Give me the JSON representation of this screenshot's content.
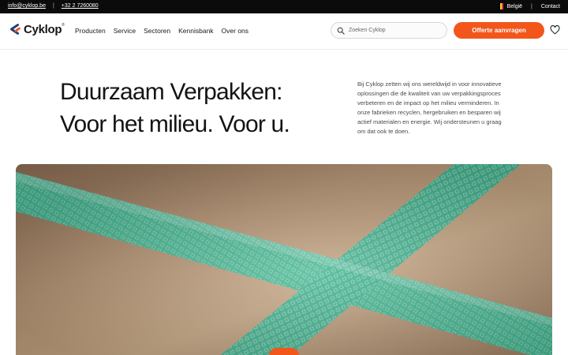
{
  "topbar": {
    "email": "info@cyklop.be",
    "phone": "+32 2 7260080",
    "country": "België",
    "contact": "Contact",
    "flag_colors": [
      "#000000",
      "#FDDA24",
      "#EF3340"
    ]
  },
  "header": {
    "logo_text": "Cyklop",
    "logo_reg": "®",
    "nav": [
      "Producten",
      "Service",
      "Sectoren",
      "Kennisbank",
      "Over ons"
    ],
    "search_placeholder": "Zoeken Cyklop",
    "cta_label": "Offerte aanvragen",
    "icons": {
      "search": "search-icon",
      "wishlist": "heart-icon",
      "logo": "cyklop-logo-icon"
    }
  },
  "hero": {
    "headline_line1": "Duurzaam Verpakken:",
    "headline_line2": "Voor het milieu. Voor u.",
    "intro": "Bij Cyklop zetten wij ons wereldwijd in voor innovatieve oplossingen die de kwaliteit van uw verpakkingsproces verbeteren en de impact op het milieu verminderen. In onze fabrieken recyclen, hergebruiken en besparen wij actief materialen en energie. Wij ondersteunen u graag om dat ook te doen.",
    "image_subject": "green strapping bands crossing on cardboard"
  },
  "colors": {
    "accent": "#f2561b",
    "topbar_bg": "#0b0b0b",
    "logo_orange": "#f2561b",
    "logo_blue": "#1b3f7a",
    "strap_green": "#3fb795"
  }
}
